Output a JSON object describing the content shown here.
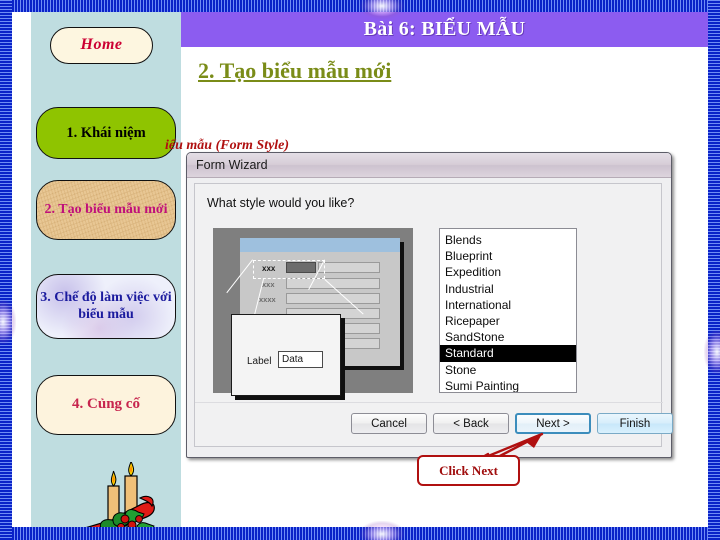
{
  "slide": {
    "header_title": "Bài 6: BIỂU MẪU",
    "subtitle": "2. Tạo biểu mẫu mới",
    "obscured_line": "iểu mẫu (Form Style)"
  },
  "sidebar": {
    "items": [
      {
        "id": "home",
        "label": "Home"
      },
      {
        "id": "muc1",
        "label": "1. Khái niệm"
      },
      {
        "id": "muc2",
        "label": "2. Tạo biểu mẫu mới"
      },
      {
        "id": "muc3",
        "label": "3. Chế độ làm việc với biểu mẫu"
      },
      {
        "id": "muc4",
        "label": "4. Củng cố"
      }
    ],
    "decoration_icon": "candles-holly-clipart"
  },
  "wizard": {
    "title": "Form Wizard",
    "question": "What style would you like?",
    "preview": {
      "rows": [
        "xxx",
        "xxx",
        "xxxx"
      ],
      "callout_label": "Label",
      "callout_data": "Data"
    },
    "styles": [
      "Blends",
      "Blueprint",
      "Expedition",
      "Industrial",
      "International",
      "Ricepaper",
      "SandStone",
      "Standard",
      "Stone",
      "Sumi Painting"
    ],
    "selected_style": "Standard",
    "buttons": {
      "cancel": "Cancel",
      "back": "< Back",
      "next": "Next >",
      "finish": "Finish"
    }
  },
  "annotation": {
    "callout_text": "Click Next"
  },
  "colors": {
    "header_purple": "#8c5cf0",
    "subtitle_olive": "#7a8c18",
    "sidebar_blue": "#bfdde0",
    "frame_blue": "#0a22c8",
    "annotation_red": "#a00d0d",
    "selected_row_bg": "#000000"
  }
}
